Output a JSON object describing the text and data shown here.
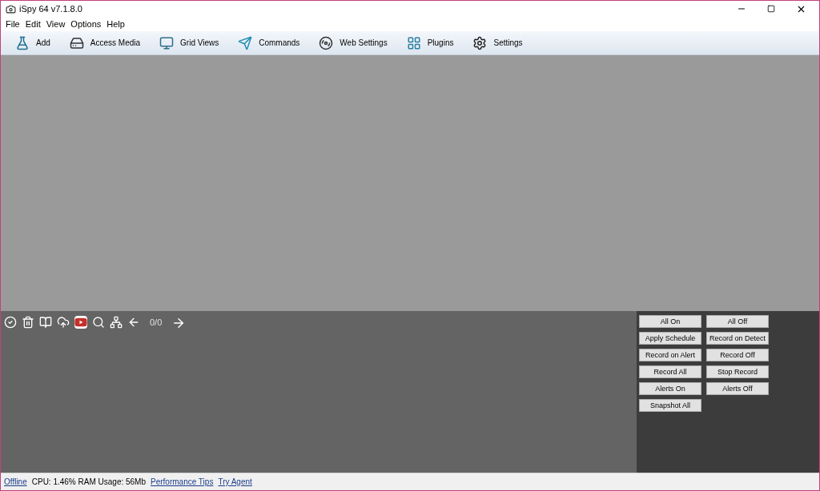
{
  "window": {
    "title": "iSpy 64 v7.1.8.0"
  },
  "menu": [
    "File",
    "Edit",
    "View",
    "Options",
    "Help"
  ],
  "toolbar": [
    {
      "kind": "add",
      "label": "Add"
    },
    {
      "kind": "media",
      "label": "Access Media"
    },
    {
      "kind": "grid",
      "label": "Grid Views"
    },
    {
      "kind": "commands",
      "label": "Commands"
    },
    {
      "kind": "web",
      "label": "Web Settings"
    },
    {
      "kind": "plugins",
      "label": "Plugins"
    },
    {
      "kind": "settings",
      "label": "Settings"
    }
  ],
  "media_bar": {
    "counter": "0/0"
  },
  "buttons": [
    "All On",
    "All Off",
    "Apply Schedule",
    "Record on Detect",
    "Record on Alert",
    "Record Off",
    "Record All",
    "Stop Record",
    "Alerts On",
    "Alerts Off",
    "Snapshot All"
  ],
  "status_bar": {
    "status": "Offline",
    "stats": "CPU: 1.46% RAM Usage: 56Mb",
    "links": [
      "Performance Tips",
      "Try Agent"
    ]
  }
}
